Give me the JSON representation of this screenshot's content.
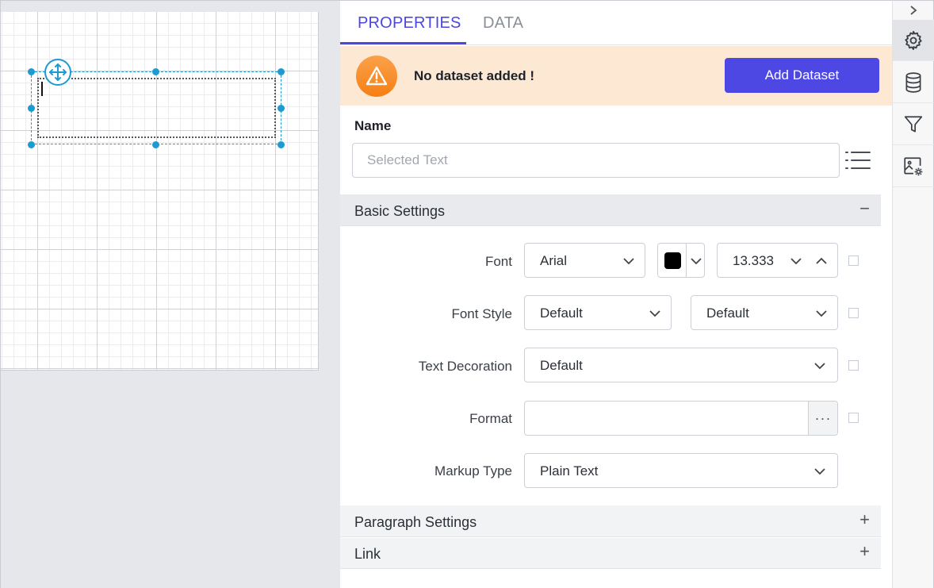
{
  "tabs": [
    {
      "label": "PROPERTIES",
      "active": true
    },
    {
      "label": "DATA",
      "active": false
    }
  ],
  "banner": {
    "message": "No dataset added !",
    "button_label": "Add Dataset",
    "icon": "warning-icon"
  },
  "name": {
    "label": "Name",
    "placeholder": "Selected Text",
    "value": ""
  },
  "sections": {
    "basic": {
      "title": "Basic Settings",
      "toggle": "−"
    },
    "paragraph": {
      "title": "Paragraph Settings",
      "toggle": "+"
    },
    "link": {
      "title": "Link",
      "toggle": "+"
    }
  },
  "basic_settings": {
    "font": {
      "label": "Font",
      "family": "Arial",
      "color": "#000000",
      "size": "13.333"
    },
    "font_style": {
      "label": "Font Style",
      "style": "Default",
      "weight": "Default"
    },
    "text_decoration": {
      "label": "Text Decoration",
      "value": "Default"
    },
    "format": {
      "label": "Format",
      "value": "",
      "button": "···"
    },
    "markup_type": {
      "label": "Markup Type",
      "value": "Plain Text"
    }
  },
  "toolbar": {
    "items": [
      "gear-icon",
      "database-icon",
      "filter-icon",
      "image-settings-icon"
    ]
  },
  "colors": {
    "accent": "#4b47e0",
    "banner_bg": "#fde9d3",
    "selection": "#1d9bd1"
  }
}
